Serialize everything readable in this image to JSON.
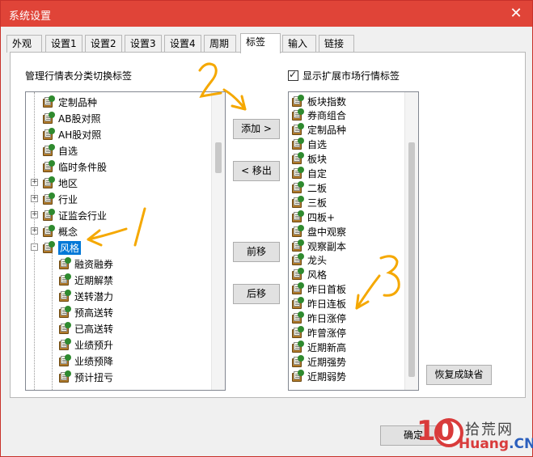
{
  "window": {
    "title": "系统设置",
    "close_glyph": "✕"
  },
  "tabs": [
    {
      "label": "外观"
    },
    {
      "label": "设置1"
    },
    {
      "label": "设置2"
    },
    {
      "label": "设置3"
    },
    {
      "label": "设置4"
    },
    {
      "label": "周期"
    },
    {
      "label": "标签",
      "active": true
    },
    {
      "label": "输入"
    },
    {
      "label": "链接"
    }
  ],
  "left_panel": {
    "label": "管理行情表分类切换标签",
    "items": [
      {
        "label": "定制品种",
        "level": 1,
        "expander": ""
      },
      {
        "label": "AB股对照",
        "level": 1,
        "expander": ""
      },
      {
        "label": "AH股对照",
        "level": 1,
        "expander": ""
      },
      {
        "label": "自选",
        "level": 1,
        "expander": ""
      },
      {
        "label": "临时条件股",
        "level": 1,
        "expander": ""
      },
      {
        "label": "地区",
        "level": 1,
        "expander": "+"
      },
      {
        "label": "行业",
        "level": 1,
        "expander": "+"
      },
      {
        "label": "证监会行业",
        "level": 1,
        "expander": "+"
      },
      {
        "label": "概念",
        "level": 1,
        "expander": "+"
      },
      {
        "label": "风格",
        "level": 1,
        "expander": "-",
        "selected": true
      },
      {
        "label": "融资融券",
        "level": 2,
        "expander": ""
      },
      {
        "label": "近期解禁",
        "level": 2,
        "expander": ""
      },
      {
        "label": "送转潜力",
        "level": 2,
        "expander": ""
      },
      {
        "label": "预高送转",
        "level": 2,
        "expander": ""
      },
      {
        "label": "已高送转",
        "level": 2,
        "expander": ""
      },
      {
        "label": "业绩预升",
        "level": 2,
        "expander": ""
      },
      {
        "label": "业绩预降",
        "level": 2,
        "expander": ""
      },
      {
        "label": "预计扭亏",
        "level": 2,
        "expander": ""
      }
    ]
  },
  "right_panel": {
    "checkbox_label": "显示扩展市场行情标签",
    "checked": true,
    "items": [
      "板块指数",
      "券商组合",
      "定制品种",
      "自选",
      "板块",
      "自定",
      "二板",
      "三板",
      "四板+",
      "盘中观察",
      "观察副本",
      "龙头",
      "风格",
      "昨日首板",
      "昨日连板",
      "昨日涨停",
      "昨曾涨停",
      "近期新高",
      "近期强势",
      "近期弱势"
    ]
  },
  "buttons": {
    "add": "添加 >",
    "remove": "< 移出",
    "move_up": "前移",
    "move_down": "后移",
    "restore_default": "恢复成缺省",
    "confirm": "确定"
  },
  "annotations": {
    "one": "1",
    "two": "2",
    "three": "3"
  },
  "watermark": {
    "number": "10",
    "cn_text": "拾荒网",
    "en_main": "Huang",
    "en_suffix": ".CN"
  },
  "colors": {
    "titlebar": "#e04438",
    "selection": "#0078d7",
    "annotation": "#f5a800",
    "watermark": "#d93b3b"
  }
}
